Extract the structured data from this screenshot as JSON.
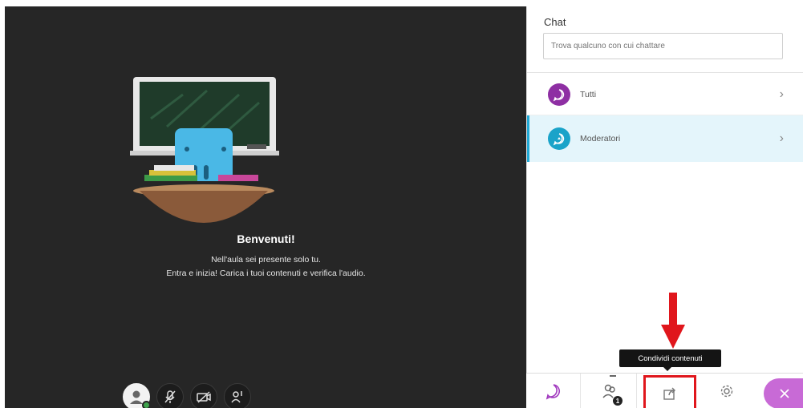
{
  "stage": {
    "welcome_title": "Benvenuti!",
    "welcome_line1": "Nell'aula sei presente solo tu.",
    "welcome_line2": "Entra e inizia! Carica i tuoi contenuti e verifica l'audio.",
    "controls": [
      "avatar",
      "microphone-muted-icon",
      "camera-off-icon",
      "raise-hand-icon"
    ]
  },
  "chat": {
    "title": "Chat",
    "search_placeholder": "Trova qualcuno con cui chattare",
    "rows": [
      {
        "label": "Tutti",
        "icon": "chat-bubble-icon",
        "color": "#8e2fa3"
      },
      {
        "label": "Moderatori",
        "icon": "moderator-chat-icon",
        "color": "#1aa3c9"
      }
    ]
  },
  "tooltip": {
    "text": "Condividi contenuti"
  },
  "bottom_bar": {
    "tabs": [
      "chat-tab",
      "attendees-tab",
      "share-content-tab",
      "settings-tab",
      "close-panel"
    ],
    "attendee_badge": "1",
    "close_color": "#c86ad6",
    "highlight_color": "#e0161c"
  }
}
